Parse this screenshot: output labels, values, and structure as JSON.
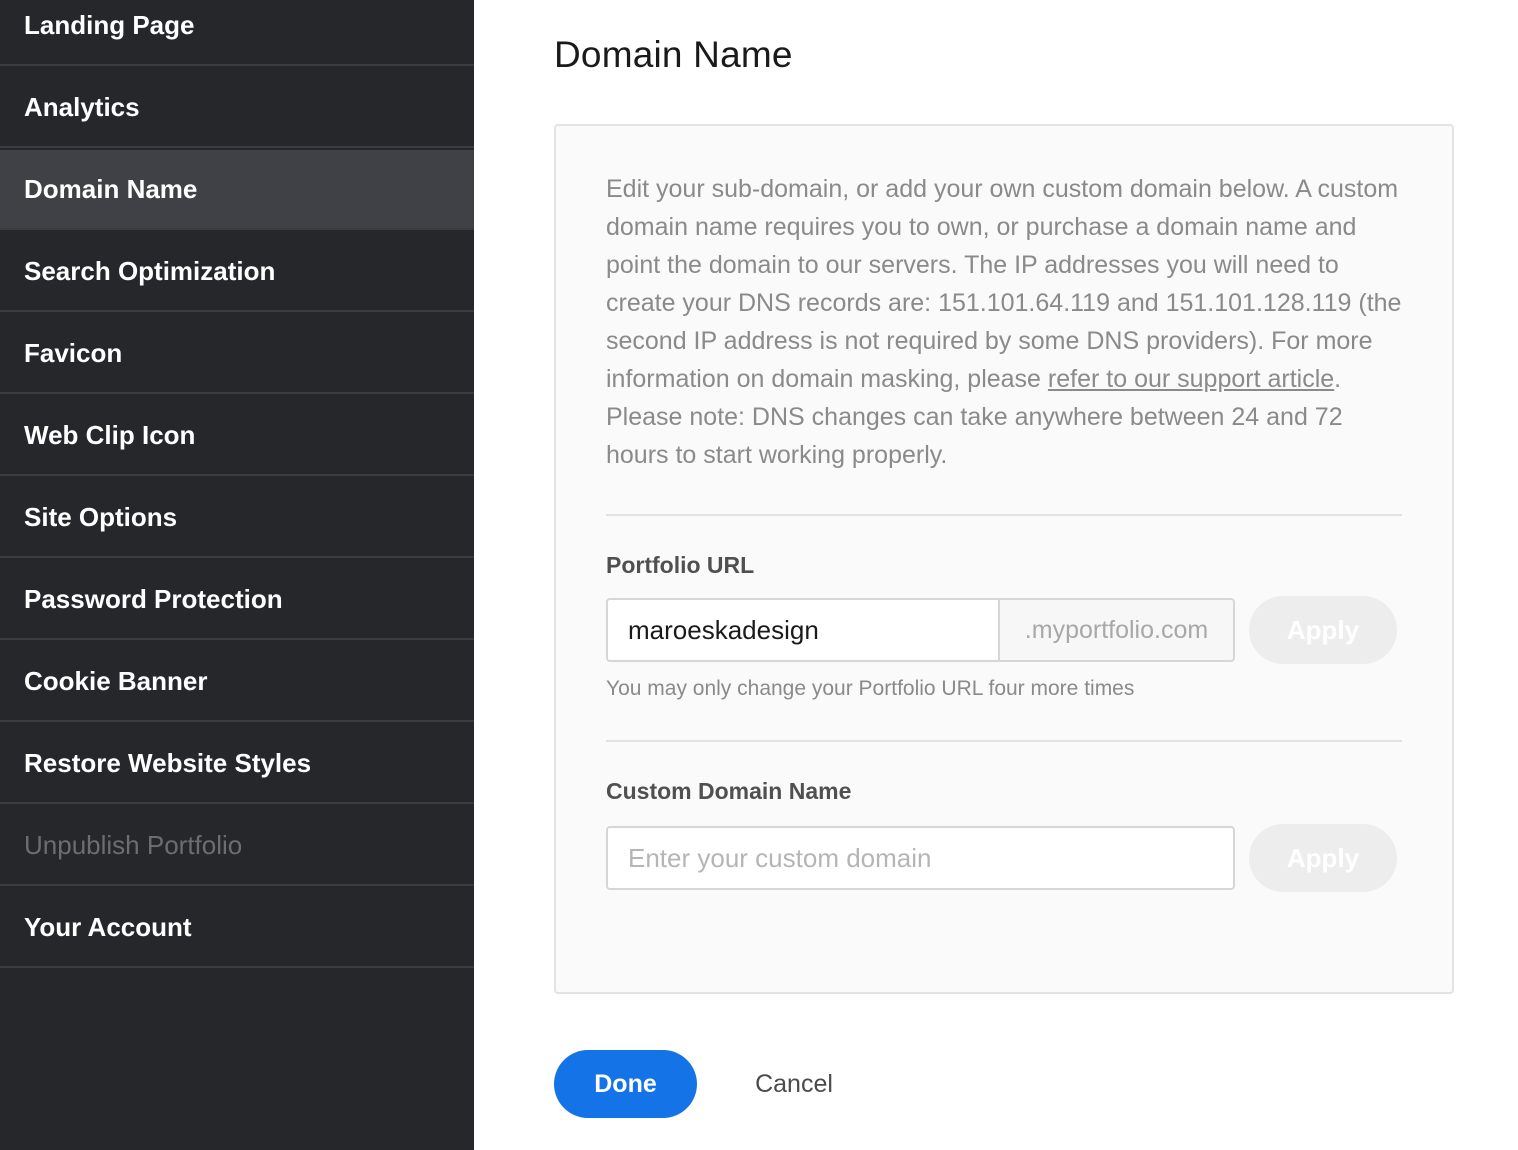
{
  "sidebar": {
    "items": [
      {
        "label": "Landing Page"
      },
      {
        "label": "Analytics"
      },
      {
        "label": "Domain Name"
      },
      {
        "label": "Search Optimization"
      },
      {
        "label": "Favicon"
      },
      {
        "label": "Web Clip Icon"
      },
      {
        "label": "Site Options"
      },
      {
        "label": "Password Protection"
      },
      {
        "label": "Cookie Banner"
      },
      {
        "label": "Restore Website Styles"
      },
      {
        "label": "Unpublish Portfolio"
      },
      {
        "label": "Your Account"
      }
    ],
    "active": "Domain Name",
    "disabled": "Unpublish Portfolio"
  },
  "main": {
    "title": "Domain Name",
    "description": {
      "text_before": "Edit your sub-domain, or add your own custom domain below. A custom domain name requires you to own, or purchase a domain name and point the domain to our servers. The IP addresses you will need to create your DNS records are: 151.101.64.119 and 151.101.128.119 (the second IP address is not required by some DNS providers). For more information on domain masking, please ",
      "link_text": "refer to our support article",
      "text_after": ". Please note: DNS changes can take anywhere between 24 and 72 hours to start working properly."
    },
    "portfolio_url": {
      "label": "Portfolio URL",
      "value": "maroeskadesign",
      "suffix": ".myportfolio.com",
      "apply_label": "Apply",
      "hint": "You may only change your Portfolio URL four more times"
    },
    "custom_domain": {
      "label": "Custom Domain Name",
      "placeholder": "Enter your custom domain",
      "apply_label": "Apply"
    },
    "done_label": "Done",
    "cancel_label": "Cancel"
  },
  "colors": {
    "sidebar_bg": "#25272b",
    "sidebar_active": "#3f4146",
    "accent": "#1473e6"
  }
}
